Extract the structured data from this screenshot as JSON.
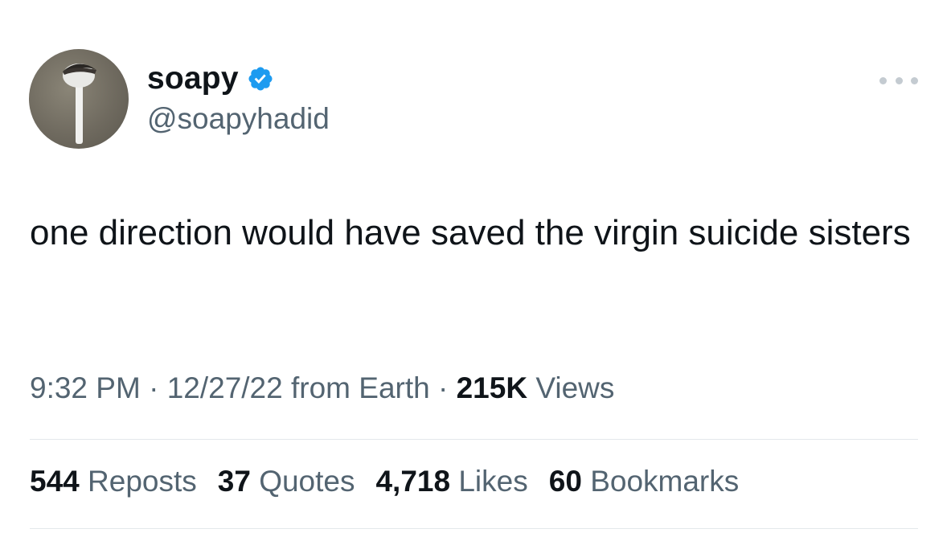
{
  "tweet": {
    "author": {
      "display_name": "soapy",
      "handle": "@soapyhadid",
      "verified": true,
      "verified_color": "#1d9bf0"
    },
    "text": "one direction would have saved the virgin suicide sisters",
    "meta": {
      "time": "9:32 PM",
      "separator": "·",
      "date": "12/27/22",
      "source": "from Earth",
      "views_count": "215K",
      "views_label": "Views"
    },
    "stats": [
      {
        "count": "544",
        "label": "Reposts"
      },
      {
        "count": "37",
        "label": "Quotes"
      },
      {
        "count": "4,718",
        "label": "Likes"
      },
      {
        "count": "60",
        "label": "Bookmarks"
      }
    ]
  }
}
